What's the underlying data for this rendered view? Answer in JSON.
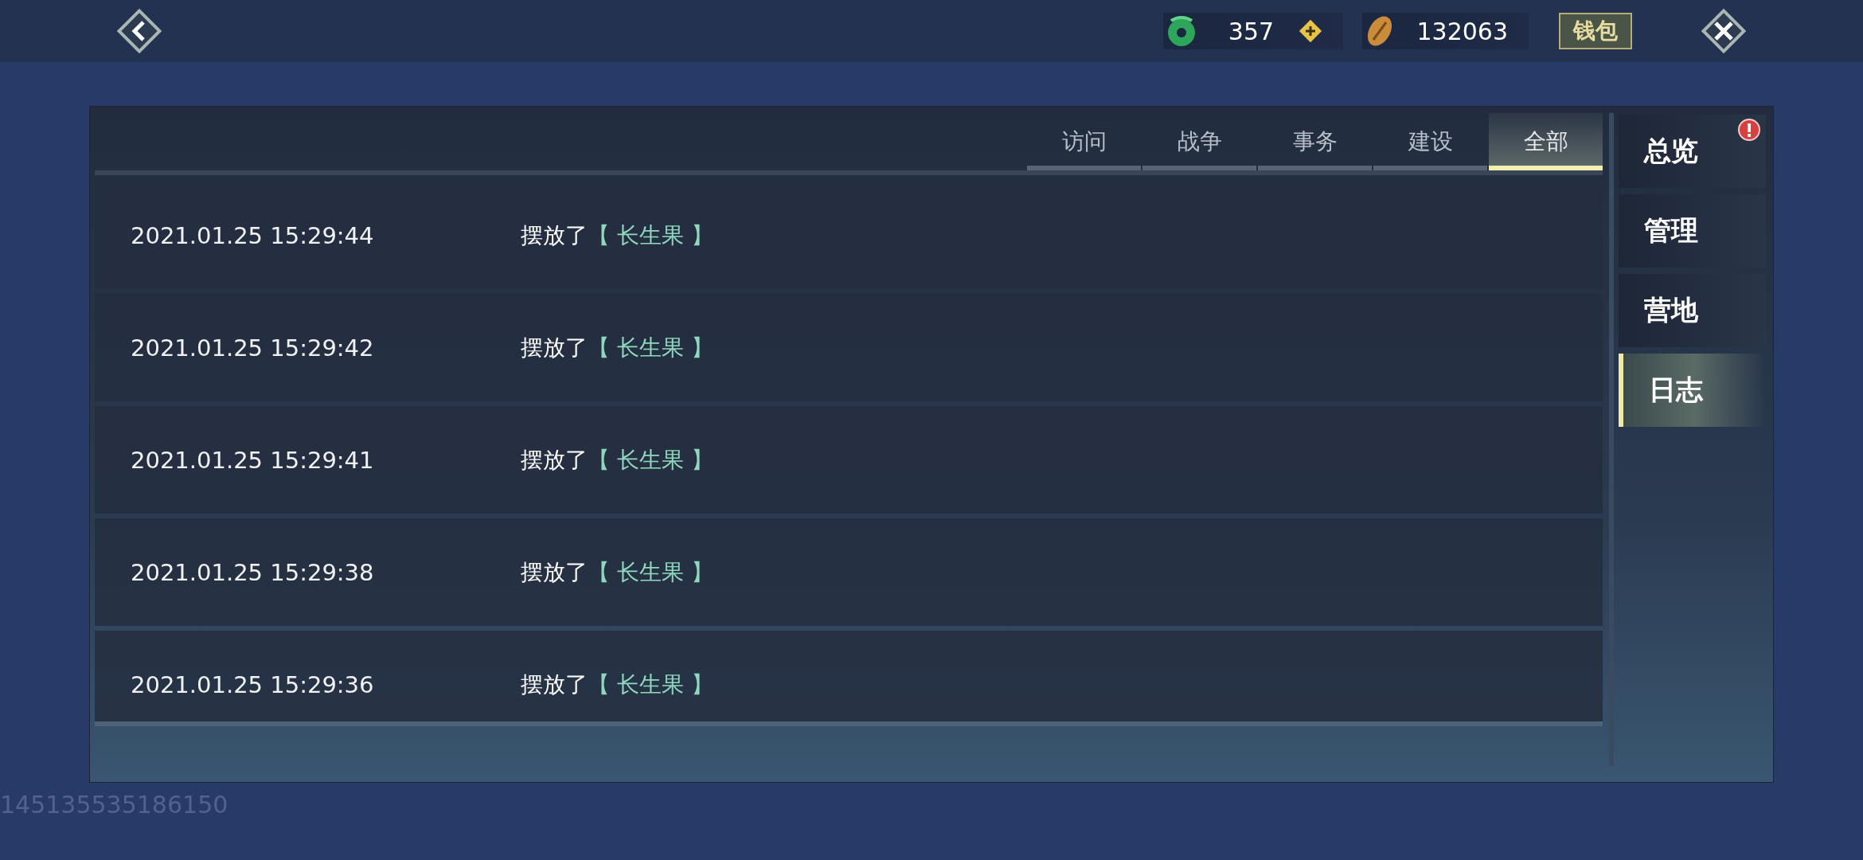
{
  "top_bar": {
    "jade": "357",
    "coins": "132063",
    "wallet_button": "钱包"
  },
  "tabs": [
    {
      "label": "访问",
      "selected": false
    },
    {
      "label": "战争",
      "selected": false
    },
    {
      "label": "事务",
      "selected": false
    },
    {
      "label": "建设",
      "selected": false
    },
    {
      "label": "全部",
      "selected": true
    }
  ],
  "log": [
    {
      "time": "2021.01.25 15:29:44",
      "action": "摆放了",
      "item": "【 长生果 】"
    },
    {
      "time": "2021.01.25 15:29:42",
      "action": "摆放了",
      "item": "【 长生果 】"
    },
    {
      "time": "2021.01.25 15:29:41",
      "action": "摆放了",
      "item": "【 长生果 】"
    },
    {
      "time": "2021.01.25 15:29:38",
      "action": "摆放了",
      "item": "【 长生果 】"
    },
    {
      "time": "2021.01.25 15:29:36",
      "action": "摆放了",
      "item": "【 长生果 】"
    }
  ],
  "sidebar": {
    "items": [
      {
        "label": "总览",
        "selected": false,
        "alert": true
      },
      {
        "label": "管理",
        "selected": false,
        "alert": false
      },
      {
        "label": "营地",
        "selected": false,
        "alert": false
      },
      {
        "label": "日志",
        "selected": true,
        "alert": false
      }
    ]
  },
  "footer_id": "145135535186150"
}
